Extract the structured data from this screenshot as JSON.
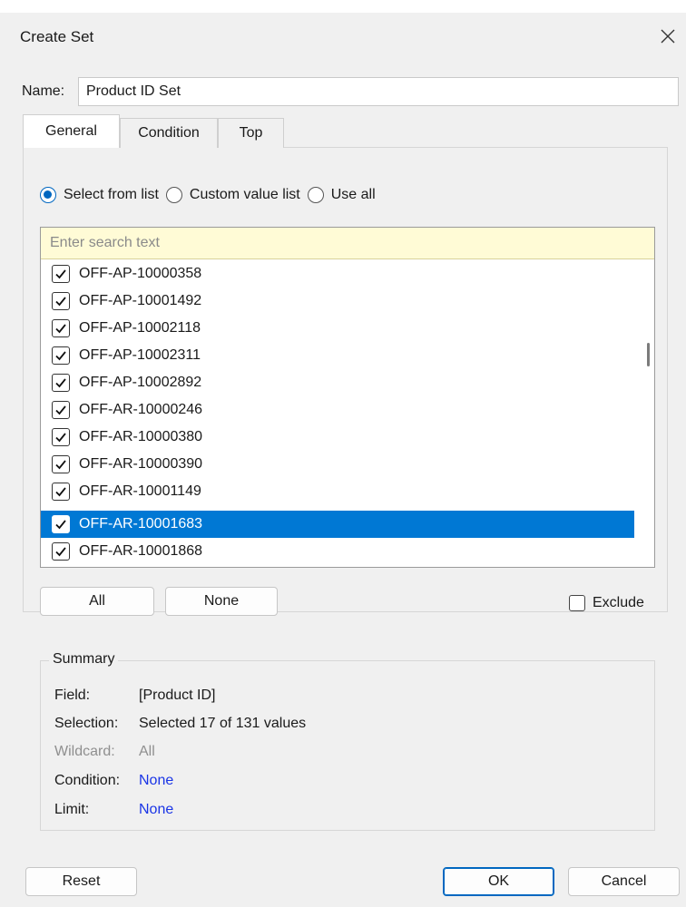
{
  "dialog": {
    "title": "Create Set"
  },
  "name": {
    "label": "Name:",
    "value": "Product ID Set"
  },
  "tabs": [
    {
      "label": "General",
      "active": true
    },
    {
      "label": "Condition",
      "active": false
    },
    {
      "label": "Top",
      "active": false
    }
  ],
  "radios": [
    {
      "label": "Select from list",
      "checked": true
    },
    {
      "label": "Custom value list",
      "checked": false
    },
    {
      "label": "Use all",
      "checked": false
    }
  ],
  "search": {
    "placeholder": "Enter search text"
  },
  "list_items": [
    {
      "label": "OFF-AP-10000358",
      "checked": true,
      "selected": false
    },
    {
      "label": "OFF-AP-10001492",
      "checked": true,
      "selected": false
    },
    {
      "label": "OFF-AP-10002118",
      "checked": true,
      "selected": false
    },
    {
      "label": "OFF-AP-10002311",
      "checked": true,
      "selected": false
    },
    {
      "label": "OFF-AP-10002892",
      "checked": true,
      "selected": false
    },
    {
      "label": "OFF-AR-10000246",
      "checked": true,
      "selected": false
    },
    {
      "label": "OFF-AR-10000380",
      "checked": true,
      "selected": false
    },
    {
      "label": "OFF-AR-10000390",
      "checked": true,
      "selected": false
    },
    {
      "label": "OFF-AR-10001149",
      "checked": true,
      "selected": false
    },
    {
      "label": "OFF-AR-10001683",
      "checked": true,
      "selected": true
    },
    {
      "label": "OFF-AR-10001868",
      "checked": true,
      "selected": false
    }
  ],
  "buttons": {
    "all": "All",
    "none": "None",
    "reset": "Reset",
    "ok": "OK",
    "cancel": "Cancel"
  },
  "exclude": {
    "label": "Exclude",
    "checked": false
  },
  "summary": {
    "legend": "Summary",
    "field": {
      "key": "Field:",
      "value": "[Product ID]"
    },
    "selection": {
      "key": "Selection:",
      "value": "Selected 17 of 131 values"
    },
    "wildcard": {
      "key": "Wildcard:",
      "value": "All"
    },
    "condition": {
      "key": "Condition:",
      "value": "None"
    },
    "limit": {
      "key": "Limit:",
      "value": "None"
    }
  },
  "colors": {
    "accent": "#0067c0",
    "selection": "#0078d4",
    "link": "#1a35e6",
    "search_bg": "#fffbd6"
  }
}
